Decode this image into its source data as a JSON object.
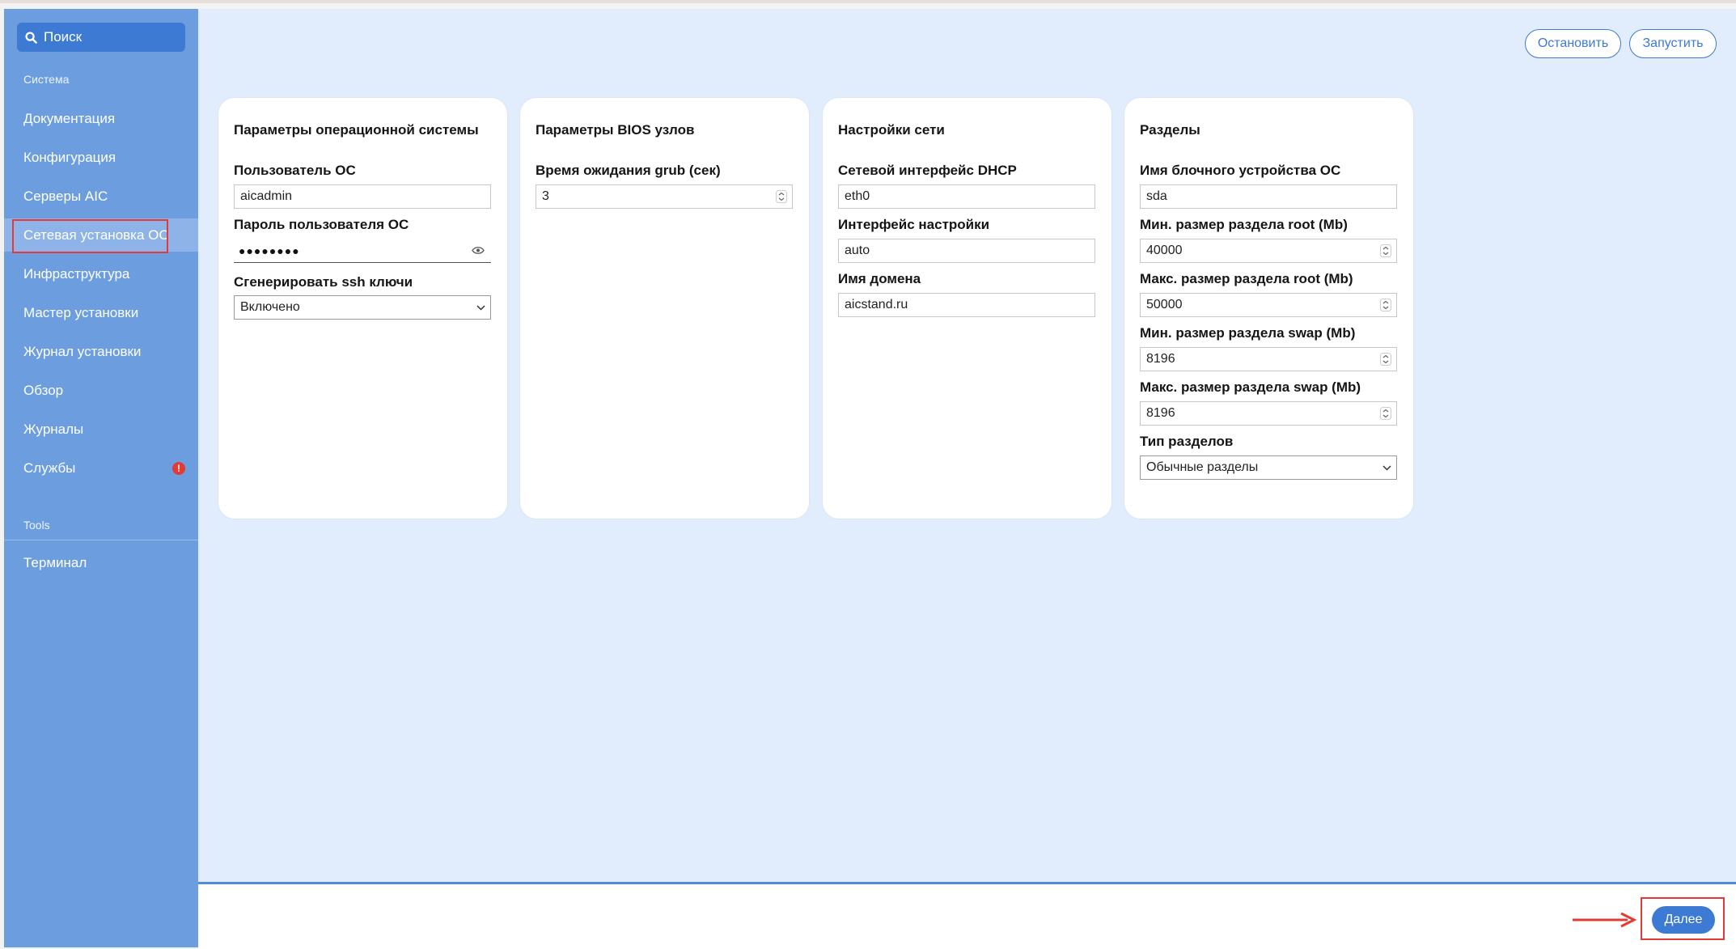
{
  "sidebar": {
    "search_label": "Поиск",
    "section_system": "Система",
    "items": [
      {
        "label": "Документация"
      },
      {
        "label": "Конфигурация"
      },
      {
        "label": "Серверы AIC"
      },
      {
        "label": "Сетевая установка ОС"
      },
      {
        "label": "Инфраструктура"
      },
      {
        "label": "Мастер установки"
      },
      {
        "label": "Журнал установки"
      },
      {
        "label": "Обзор"
      },
      {
        "label": "Журналы"
      },
      {
        "label": "Службы"
      }
    ],
    "active_item": "Сетевая установка ОС",
    "services_badge": "!",
    "section_tools": "Tools",
    "tools_items": [
      {
        "label": "Терминал"
      }
    ]
  },
  "toolbar": {
    "stop_label": "Остановить",
    "start_label": "Запустить"
  },
  "cards": {
    "os": {
      "title": "Параметры операционной системы",
      "user_label": "Пользователь ОС",
      "user_value": "aicadmin",
      "password_label": "Пароль пользователя ОС",
      "password_mask": "●●●●●●●●",
      "ssh_label": "Сгенерировать ssh ключи",
      "ssh_value": "Включено"
    },
    "bios": {
      "title": "Параметры BIOS узлов",
      "grub_label": "Время ожидания grub (сек)",
      "grub_value": "3"
    },
    "network": {
      "title": "Настройки сети",
      "dhcp_label": "Сетевой интерфейс DHCP",
      "dhcp_value": "eth0",
      "iface_label": "Интерфейс настройки",
      "iface_value": "auto",
      "domain_label": "Имя домена",
      "domain_value": "aicstand.ru"
    },
    "partitions": {
      "title": "Разделы",
      "device_label": "Имя блочного устройства ОС",
      "device_value": "sda",
      "min_root_label": "Мин. размер раздела root (Mb)",
      "min_root_value": "40000",
      "max_root_label": "Макс. размер раздела root (Mb)",
      "max_root_value": "50000",
      "min_swap_label": "Мин. размер раздела swap (Mb)",
      "min_swap_value": "8196",
      "max_swap_label": "Макс. размер раздела swap (Mb)",
      "max_swap_value": "8196",
      "type_label": "Тип разделов",
      "type_value": "Обычные разделы"
    }
  },
  "footer": {
    "next_label": "Далее"
  },
  "colors": {
    "sidebar_bg": "#6c9edf",
    "accent": "#3d7ad3",
    "content_bg": "#e1edfc",
    "highlight": "#e53935"
  }
}
